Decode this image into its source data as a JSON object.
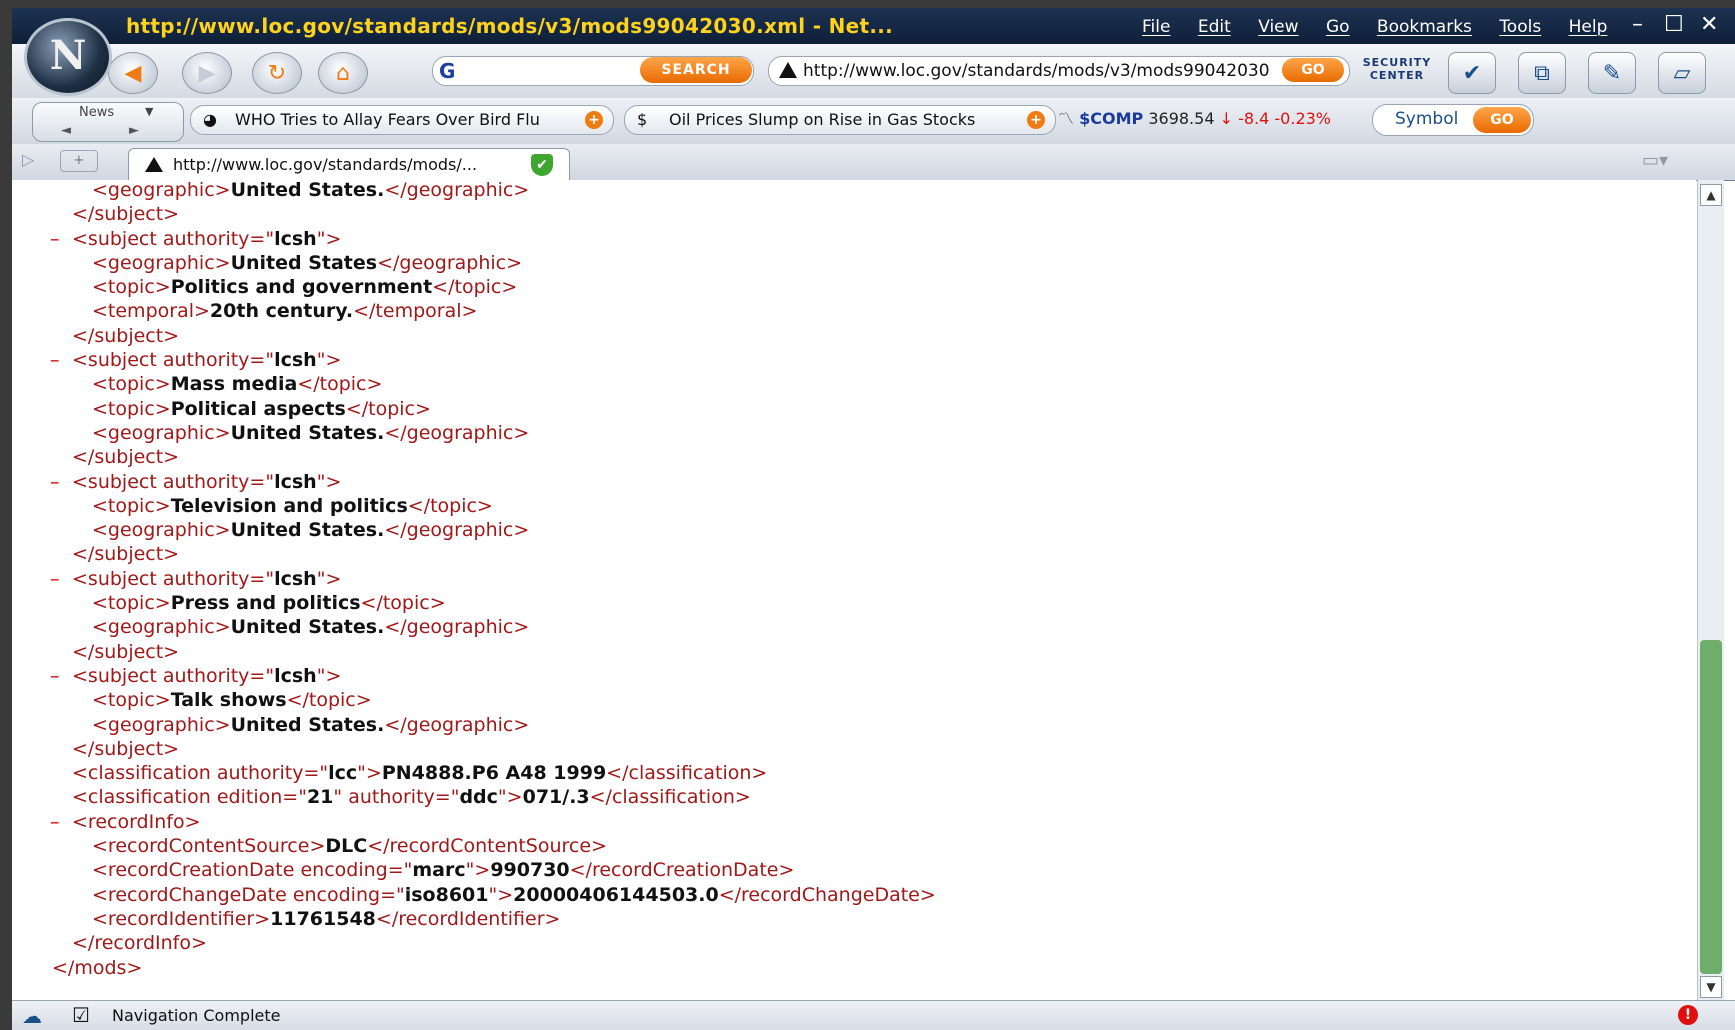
{
  "window": {
    "title": "http://www.loc.gov/standards/mods/v3/mods99042030.xml - Net...",
    "menus": [
      "File",
      "Edit",
      "View",
      "Go",
      "Bookmarks",
      "Tools",
      "Help"
    ]
  },
  "navbar": {
    "search_button": "SEARCH",
    "url": "http://www.loc.gov/standards/mods/v3/mods99042030",
    "go_label": "GO",
    "security_center": "SECURITY CENTER"
  },
  "toolbar2": {
    "news_label": "News",
    "news_items": [
      "WHO Tries to Allay Fears Over Bird Flu",
      "Oil Prices Slump on Rise in Gas Stocks"
    ],
    "stock": {
      "symbol": "$COMP",
      "value": "3698.54",
      "change": "-8.4",
      "percent": "-0.23%"
    },
    "symbol_label": "Symbol",
    "symbol_go": "GO"
  },
  "tab": {
    "label": "http://www.loc.gov/standards/mods/..."
  },
  "status": {
    "text": "Navigation Complete"
  },
  "xml_lines": [
    {
      "indent": 2,
      "minus": false,
      "open": "geographic",
      "attrs": [],
      "value": "United States.",
      "close": "geographic"
    },
    {
      "indent": 1,
      "minus": false,
      "close_only": "subject"
    },
    {
      "indent": 1,
      "minus": true,
      "open": "subject",
      "attrs": [
        [
          "authority",
          "lcsh"
        ]
      ]
    },
    {
      "indent": 2,
      "minus": false,
      "open": "geographic",
      "attrs": [],
      "value": "United States",
      "close": "geographic"
    },
    {
      "indent": 2,
      "minus": false,
      "open": "topic",
      "attrs": [],
      "value": "Politics and government",
      "close": "topic"
    },
    {
      "indent": 2,
      "minus": false,
      "open": "temporal",
      "attrs": [],
      "value": "20th century.",
      "close": "temporal"
    },
    {
      "indent": 1,
      "minus": false,
      "close_only": "subject"
    },
    {
      "indent": 1,
      "minus": true,
      "open": "subject",
      "attrs": [
        [
          "authority",
          "lcsh"
        ]
      ]
    },
    {
      "indent": 2,
      "minus": false,
      "open": "topic",
      "attrs": [],
      "value": "Mass media",
      "close": "topic"
    },
    {
      "indent": 2,
      "minus": false,
      "open": "topic",
      "attrs": [],
      "value": "Political aspects",
      "close": "topic"
    },
    {
      "indent": 2,
      "minus": false,
      "open": "geographic",
      "attrs": [],
      "value": "United States.",
      "close": "geographic"
    },
    {
      "indent": 1,
      "minus": false,
      "close_only": "subject"
    },
    {
      "indent": 1,
      "minus": true,
      "open": "subject",
      "attrs": [
        [
          "authority",
          "lcsh"
        ]
      ]
    },
    {
      "indent": 2,
      "minus": false,
      "open": "topic",
      "attrs": [],
      "value": "Television and politics",
      "close": "topic"
    },
    {
      "indent": 2,
      "minus": false,
      "open": "geographic",
      "attrs": [],
      "value": "United States.",
      "close": "geographic"
    },
    {
      "indent": 1,
      "minus": false,
      "close_only": "subject"
    },
    {
      "indent": 1,
      "minus": true,
      "open": "subject",
      "attrs": [
        [
          "authority",
          "lcsh"
        ]
      ]
    },
    {
      "indent": 2,
      "minus": false,
      "open": "topic",
      "attrs": [],
      "value": "Press and politics",
      "close": "topic"
    },
    {
      "indent": 2,
      "minus": false,
      "open": "geographic",
      "attrs": [],
      "value": "United States.",
      "close": "geographic"
    },
    {
      "indent": 1,
      "minus": false,
      "close_only": "subject"
    },
    {
      "indent": 1,
      "minus": true,
      "open": "subject",
      "attrs": [
        [
          "authority",
          "lcsh"
        ]
      ]
    },
    {
      "indent": 2,
      "minus": false,
      "open": "topic",
      "attrs": [],
      "value": "Talk shows",
      "close": "topic"
    },
    {
      "indent": 2,
      "minus": false,
      "open": "geographic",
      "attrs": [],
      "value": "United States.",
      "close": "geographic"
    },
    {
      "indent": 1,
      "minus": false,
      "close_only": "subject"
    },
    {
      "indent": 1,
      "minus": false,
      "open": "classification",
      "attrs": [
        [
          "authority",
          "lcc"
        ]
      ],
      "value": "PN4888.P6 A48 1999",
      "close": "classification"
    },
    {
      "indent": 1,
      "minus": false,
      "open": "classification",
      "attrs": [
        [
          "edition",
          "21"
        ],
        [
          "authority",
          "ddc"
        ]
      ],
      "value": "071/.3",
      "close": "classification"
    },
    {
      "indent": 1,
      "minus": true,
      "open": "recordInfo",
      "attrs": []
    },
    {
      "indent": 2,
      "minus": false,
      "open": "recordContentSource",
      "attrs": [],
      "value": "DLC",
      "close": "recordContentSource"
    },
    {
      "indent": 2,
      "minus": false,
      "open": "recordCreationDate",
      "attrs": [
        [
          "encoding",
          "marc"
        ]
      ],
      "value": "990730",
      "close": "recordCreationDate"
    },
    {
      "indent": 2,
      "minus": false,
      "open": "recordChangeDate",
      "attrs": [
        [
          "encoding",
          "iso8601"
        ]
      ],
      "value": "20000406144503.0",
      "close": "recordChangeDate"
    },
    {
      "indent": 2,
      "minus": false,
      "open": "recordIdentifier",
      "attrs": [],
      "value": "11761548",
      "close": "recordIdentifier"
    },
    {
      "indent": 1,
      "minus": false,
      "close_only": "recordInfo"
    },
    {
      "indent": 0,
      "minus": false,
      "close_only": "mods"
    }
  ],
  "colors": {
    "tag": "#a01818",
    "value": "#111111",
    "accent": "#e86a00",
    "title": "#ffd21c"
  }
}
